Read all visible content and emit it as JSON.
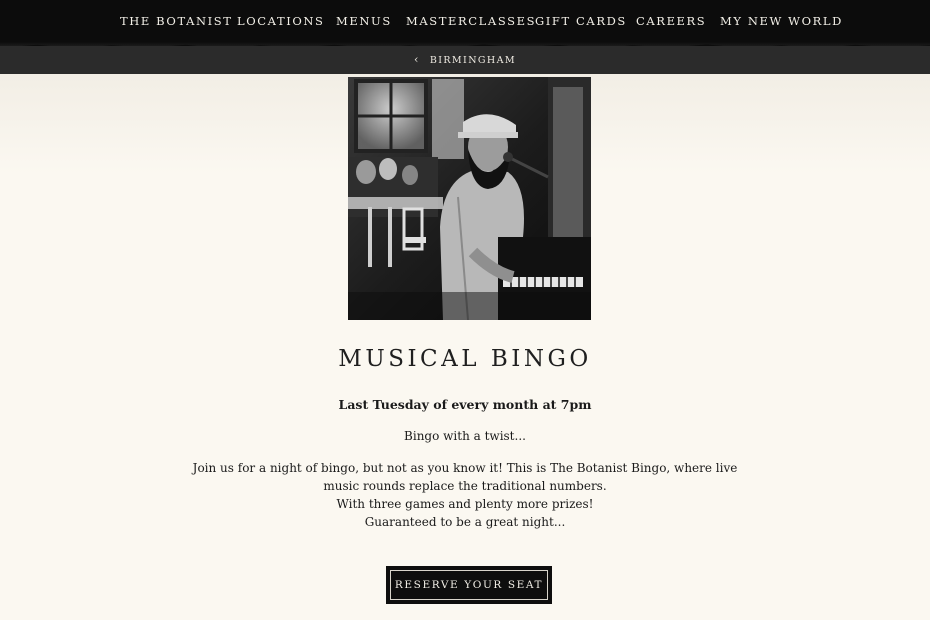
{
  "nav": {
    "items": [
      {
        "label": "THE BOTANIST"
      },
      {
        "label": "LOCATIONS"
      },
      {
        "label": "MENUS"
      },
      {
        "label": "MASTERCLASSES"
      },
      {
        "label": "GIFT CARDS"
      },
      {
        "label": "CAREERS"
      },
      {
        "label": "MY NEW WORLD"
      }
    ]
  },
  "breadcrumb": {
    "label": "BIRMINGHAM",
    "icon": "chevron-left-icon"
  },
  "event": {
    "title": "MUSICAL BINGO",
    "schedule": "Last Tuesday of every month at 7pm",
    "tagline": "Bingo with a twist...",
    "description": [
      "Join us for a night of bingo, but not as you know it! This is The Botanist Bingo, where live music rounds replace the traditional numbers.",
      "With three games and plenty more prizes!",
      "Guaranteed to be a great night..."
    ],
    "cta_label": "RESERVE YOUR SEAT"
  },
  "colors": {
    "nav_bg": "#0c0c0c",
    "subbar_bg": "#2b2b2b",
    "page_bg": "#fbf8f1",
    "button_bg": "#0e0e0e"
  }
}
